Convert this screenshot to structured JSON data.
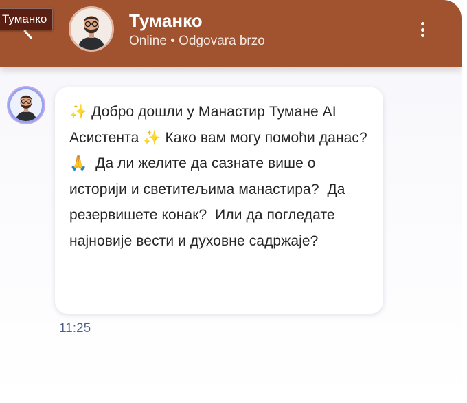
{
  "tooltip": {
    "text": "Туманко"
  },
  "header": {
    "title": "Туманко",
    "status": "Online • Odgovara brzo"
  },
  "message": {
    "text": "✨ Добро дошли у Манастир Тумане AI Асистента ✨ Како вам могу помоћи данас? 🙏  Да ли желите да сазнате више о историји и светитељима манастира?  Да резервишете конак?  Или да погледате најновије вести и духовне садржаје?",
    "time": "11:25"
  },
  "icons": {
    "back": "chevron-left-icon",
    "menu": "more-vertical-icon",
    "avatar": "bearded-man-avatar"
  },
  "colors": {
    "header_bg": "#a1522f",
    "timestamp": "#4e5f8e",
    "bubble_bg": "#ffffff"
  }
}
